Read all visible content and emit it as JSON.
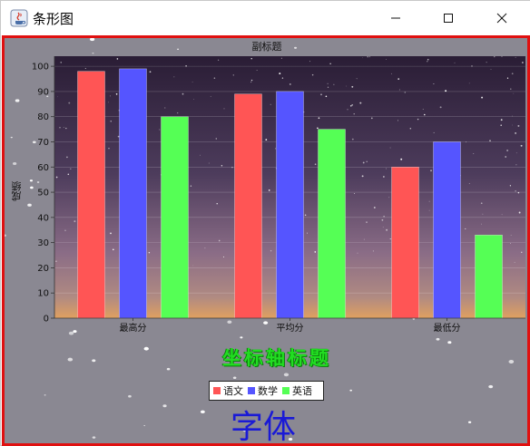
{
  "window": {
    "title": "条形图"
  },
  "chart_data": {
    "type": "bar",
    "title": "",
    "subtitle": "副标题",
    "xlabel": "坐标轴标题",
    "ylabel": "成绩",
    "categories": [
      "最高分",
      "平均分",
      "最低分"
    ],
    "series": [
      {
        "name": "语文",
        "color": "#ff5555",
        "values": [
          98,
          89,
          60
        ]
      },
      {
        "name": "数学",
        "color": "#5555ff",
        "values": [
          99,
          90,
          70
        ]
      },
      {
        "name": "英语",
        "color": "#55ff55",
        "values": [
          80,
          75,
          33
        ]
      }
    ],
    "ylim": [
      0,
      104
    ],
    "yticks": [
      0,
      10,
      20,
      30,
      40,
      50,
      60,
      70,
      80,
      90,
      100
    ],
    "legend_position": "bottom"
  },
  "footer_text": "字体"
}
